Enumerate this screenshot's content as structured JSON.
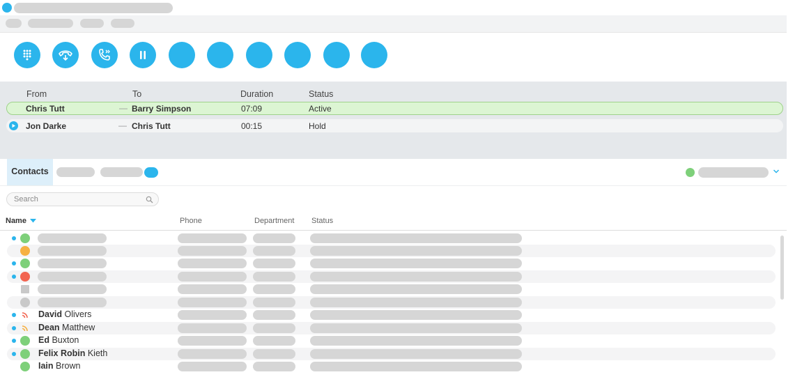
{
  "toolbar": {
    "buttons": [
      {
        "name": "dialpad-button",
        "icon": "dialpad-icon"
      },
      {
        "name": "hangup-button",
        "icon": "phone-hangup-icon"
      },
      {
        "name": "transfer-button",
        "icon": "phone-forward-icon"
      },
      {
        "name": "hold-button",
        "icon": "pause-icon"
      },
      {
        "name": "toolbar-button-5",
        "icon": ""
      },
      {
        "name": "toolbar-button-6",
        "icon": ""
      },
      {
        "name": "toolbar-button-7",
        "icon": ""
      },
      {
        "name": "toolbar-button-8",
        "icon": ""
      },
      {
        "name": "toolbar-button-9",
        "icon": ""
      },
      {
        "name": "toolbar-button-10",
        "icon": ""
      }
    ]
  },
  "calls": {
    "headers": {
      "from": "From",
      "to": "To",
      "duration": "Duration",
      "status": "Status"
    },
    "rows": [
      {
        "from": "Chris Tutt",
        "to": "Barry Simpson",
        "duration": "07:09",
        "status": "Active"
      },
      {
        "from": "Jon Darke",
        "to": "Chris Tutt",
        "duration": "00:15",
        "status": "Hold"
      }
    ],
    "separator": "—"
  },
  "tabs": {
    "contacts": "Contacts"
  },
  "search": {
    "placeholder": "Search"
  },
  "contacts": {
    "headers": {
      "name": "Name",
      "phone": "Phone",
      "department": "Department",
      "status": "Status"
    },
    "rows": [
      {
        "first": "David",
        "last": " Olivers"
      },
      {
        "first": "Dean",
        "last": " Matthew"
      },
      {
        "first": "Ed",
        "last": " Buxton"
      },
      {
        "first": "Felix Robin",
        "last": " Kieth"
      },
      {
        "first": "Iain",
        "last": " Brown"
      }
    ]
  },
  "colors": {
    "accent": "#2bb5ec",
    "available": "#7ed07a",
    "away": "#f6b142",
    "busy": "#f26450",
    "offline": "#c9c9c9",
    "active_call_bg": "#dcf5d3"
  }
}
